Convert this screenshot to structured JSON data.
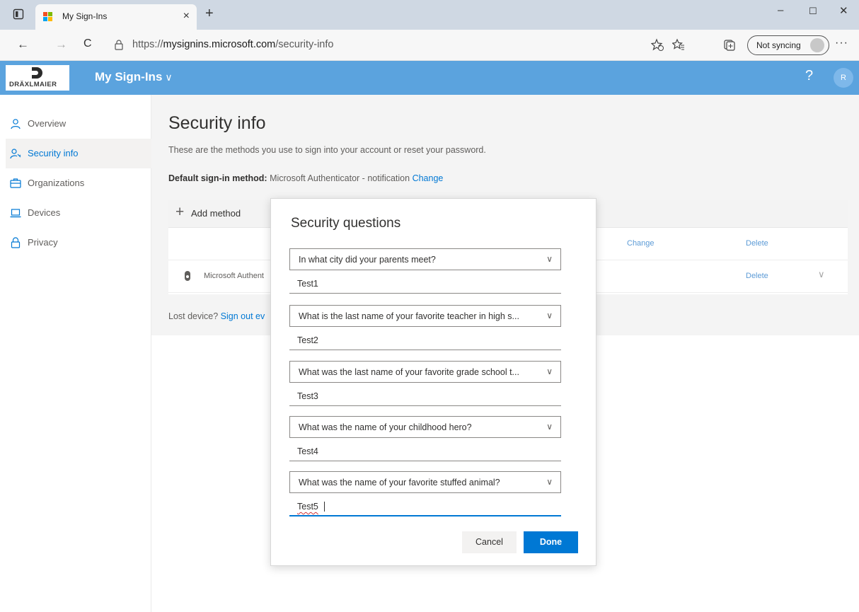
{
  "browser": {
    "tab_title": "My Sign-Ins",
    "tab_close": "×",
    "new_tab": "+",
    "window_controls": {
      "minimize": "–",
      "maximize": "☐",
      "close": "✕"
    },
    "nav": {
      "back": "←",
      "forward": "→",
      "refresh": "C"
    },
    "url_prefix": "https://",
    "url_domain": "mysignins.microsoft.com",
    "url_path": "/security-info",
    "sync_label": "Not syncing",
    "more": "···",
    "icons": [
      "tab-actions-icon",
      "lock-icon",
      "add-favorite-icon",
      "favorites-icon",
      "collections-icon",
      "profile-icon"
    ]
  },
  "header": {
    "logo_brand": "DRÄXLMAIER",
    "app_title": "My Sign-Ins",
    "app_title_chevron": "∨",
    "help": "?",
    "avatar_initial": "R",
    "color": "#5ba3de"
  },
  "sidebar": {
    "items": [
      {
        "label": "Overview",
        "icon": "person-icon",
        "active": false
      },
      {
        "label": "Security info",
        "icon": "person-key-icon",
        "active": true
      },
      {
        "label": "Organizations",
        "icon": "briefcase-icon",
        "active": false
      },
      {
        "label": "Devices",
        "icon": "laptop-icon",
        "active": false
      },
      {
        "label": "Privacy",
        "icon": "lock-icon",
        "active": false
      }
    ]
  },
  "main": {
    "title": "Security info",
    "subtitle": "These are the methods you use to sign into your account or reset your password.",
    "default_label": "Default sign-in method:",
    "default_value": "Microsoft Authenticator - notification",
    "default_change": "Change",
    "add_method_icon": "+",
    "add_method": "Add method",
    "rows": [
      {
        "name": "",
        "change": "Change",
        "delete": "Delete"
      },
      {
        "name": "Microsoft Authent",
        "delete": "Delete",
        "chevron": "∨"
      }
    ],
    "lost_device_text": "Lost device?",
    "lost_device_link": "Sign out ev"
  },
  "dialog": {
    "title": "Security questions",
    "chevron": "∨",
    "questions": [
      {
        "question": "In what city did your parents meet?",
        "answer": "Test1"
      },
      {
        "question": "What is the last name of your favorite teacher in high s...",
        "answer": "Test2"
      },
      {
        "question": "What was the last name of your favorite grade school t...",
        "answer": "Test3"
      },
      {
        "question": "What was the name of your childhood hero?",
        "answer": "Test4"
      },
      {
        "question": "What was the name of your favorite stuffed animal?",
        "answer": "Test5"
      }
    ],
    "cancel_label": "Cancel",
    "done_label": "Done",
    "accent": "#0078d4"
  }
}
